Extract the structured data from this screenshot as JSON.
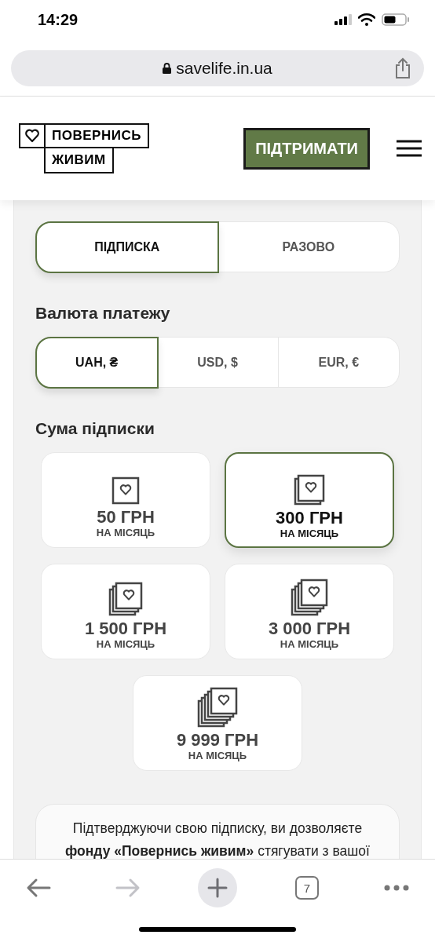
{
  "status_bar": {
    "time": "14:29"
  },
  "browser": {
    "url": "savelife.in.ua"
  },
  "header": {
    "logo": {
      "line_1": "ПОВЕРНИСЬ",
      "line_2": "ЖИВИМ"
    },
    "support_button": "ПІДТРИМАТИ"
  },
  "periodicity": {
    "options": [
      {
        "label": "ПІДПИСКА",
        "selected": true
      },
      {
        "label": "РАЗОВО",
        "selected": false
      }
    ]
  },
  "currency": {
    "title": "Валюта платежу",
    "options": [
      {
        "label": "UAH, ₴",
        "selected": true
      },
      {
        "label": "USD, $",
        "selected": false
      },
      {
        "label": "EUR, €",
        "selected": false
      }
    ]
  },
  "amount": {
    "title": "Сума підписки",
    "options": [
      {
        "amount": "50 ГРН",
        "period": "НА МІСЯЦЬ",
        "selected": false
      },
      {
        "amount": "300 ГРН",
        "period": "НА МІСЯЦЬ",
        "selected": true
      },
      {
        "amount": "1 500 ГРН",
        "period": "НА МІСЯЦЬ",
        "selected": false
      },
      {
        "amount": "3 000 ГРН",
        "period": "НА МІСЯЦЬ",
        "selected": false
      },
      {
        "amount": "9 999 ГРН",
        "period": "НА МІСЯЦЬ",
        "selected": false
      }
    ]
  },
  "consent_text": "Підтверджуючи свою підписку, ви дозволяєте **фонду «Повернись живим»** стягувати з вашої",
  "toolbar": {
    "items": [
      {
        "kind": "back",
        "disabled": false
      },
      {
        "kind": "forward",
        "disabled": true
      },
      {
        "kind": "new-tab",
        "disabled": false
      },
      {
        "kind": "tabs",
        "label": "7",
        "disabled": false
      },
      {
        "kind": "more",
        "disabled": false
      }
    ]
  }
}
